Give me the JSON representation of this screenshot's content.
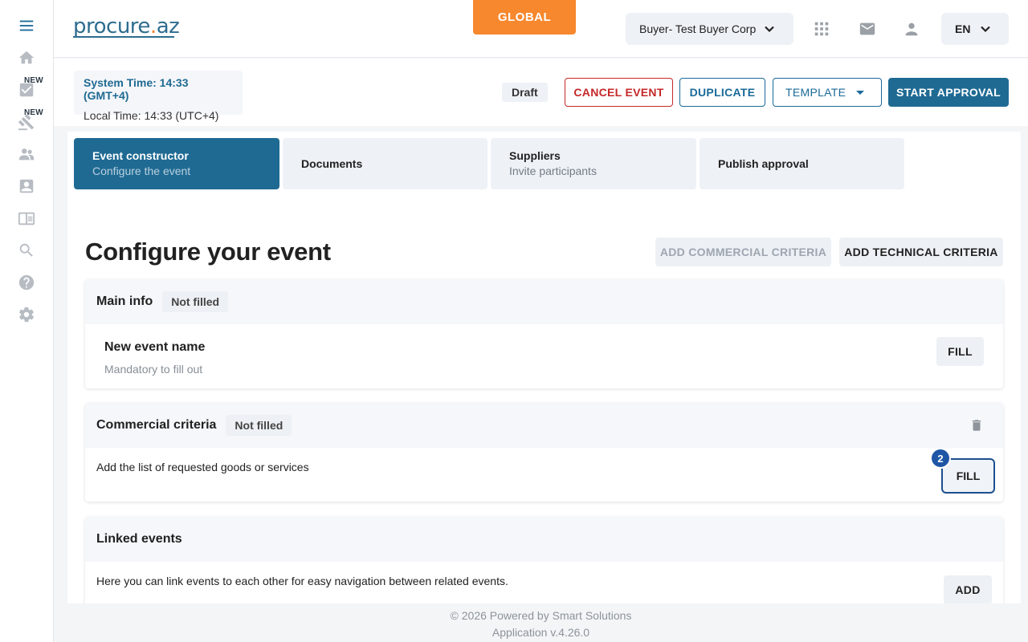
{
  "sidebar": {
    "items": [
      {
        "name": "menu",
        "icon": "menu-icon"
      },
      {
        "name": "home",
        "icon": "home-icon"
      },
      {
        "name": "tasks",
        "icon": "check-box-icon",
        "badge": "NEW"
      },
      {
        "name": "auctions",
        "icon": "gavel-icon",
        "badge": "NEW"
      },
      {
        "name": "suppliers",
        "icon": "people-icon"
      },
      {
        "name": "contacts",
        "icon": "contact-card-icon"
      },
      {
        "name": "catalog",
        "icon": "book-icon"
      },
      {
        "name": "search",
        "icon": "search-icon"
      },
      {
        "name": "help",
        "icon": "help-icon"
      },
      {
        "name": "settings",
        "icon": "gear-icon"
      }
    ]
  },
  "header": {
    "logo": {
      "part1": "procure",
      "dot": ".",
      "part2": "az"
    },
    "global_label": "GLOBAL",
    "buyer_label": "Buyer- Test Buyer Corp",
    "language": "EN"
  },
  "toolbar": {
    "system_time": "System Time: 14:33 (GMT+4)",
    "local_time": "Local Time: 14:33 (UTC+4)",
    "status": "Draft",
    "cancel_label": "CANCEL EVENT",
    "duplicate_label": "DUPLICATE",
    "template_label": "TEMPLATE",
    "start_label": "START APPROVAL"
  },
  "steps": [
    {
      "title": "Event constructor",
      "subtitle": "Configure the event",
      "active": true
    },
    {
      "title": "Documents",
      "subtitle": ""
    },
    {
      "title": "Suppliers",
      "subtitle": "Invite participants"
    },
    {
      "title": "Publish approval",
      "subtitle": ""
    }
  ],
  "main": {
    "title": "Configure your event",
    "add_commercial_label": "ADD COMMERCIAL CRITERIA",
    "add_technical_label": "ADD TECHNICAL CRITERIA",
    "sections": {
      "main_info": {
        "title": "Main info",
        "status": "Not filled",
        "item_title": "New event name",
        "item_sub": "Mandatory to fill out",
        "button": "FILL"
      },
      "commercial": {
        "title": "Commercial criteria",
        "status": "Not filled",
        "text": "Add the list of requested goods or services",
        "button": "FILL",
        "marker": "2"
      },
      "linked": {
        "title": "Linked events",
        "text": "Here you can link events to each other for easy navigation between related events.",
        "button": "ADD"
      }
    }
  },
  "footer": {
    "copyright": "© 2026 Powered by Smart Solutions",
    "version": "Application v.4.26.0"
  },
  "colors": {
    "primary": "#1f6a93",
    "accent_orange": "#f7882e",
    "danger": "#c62828"
  }
}
